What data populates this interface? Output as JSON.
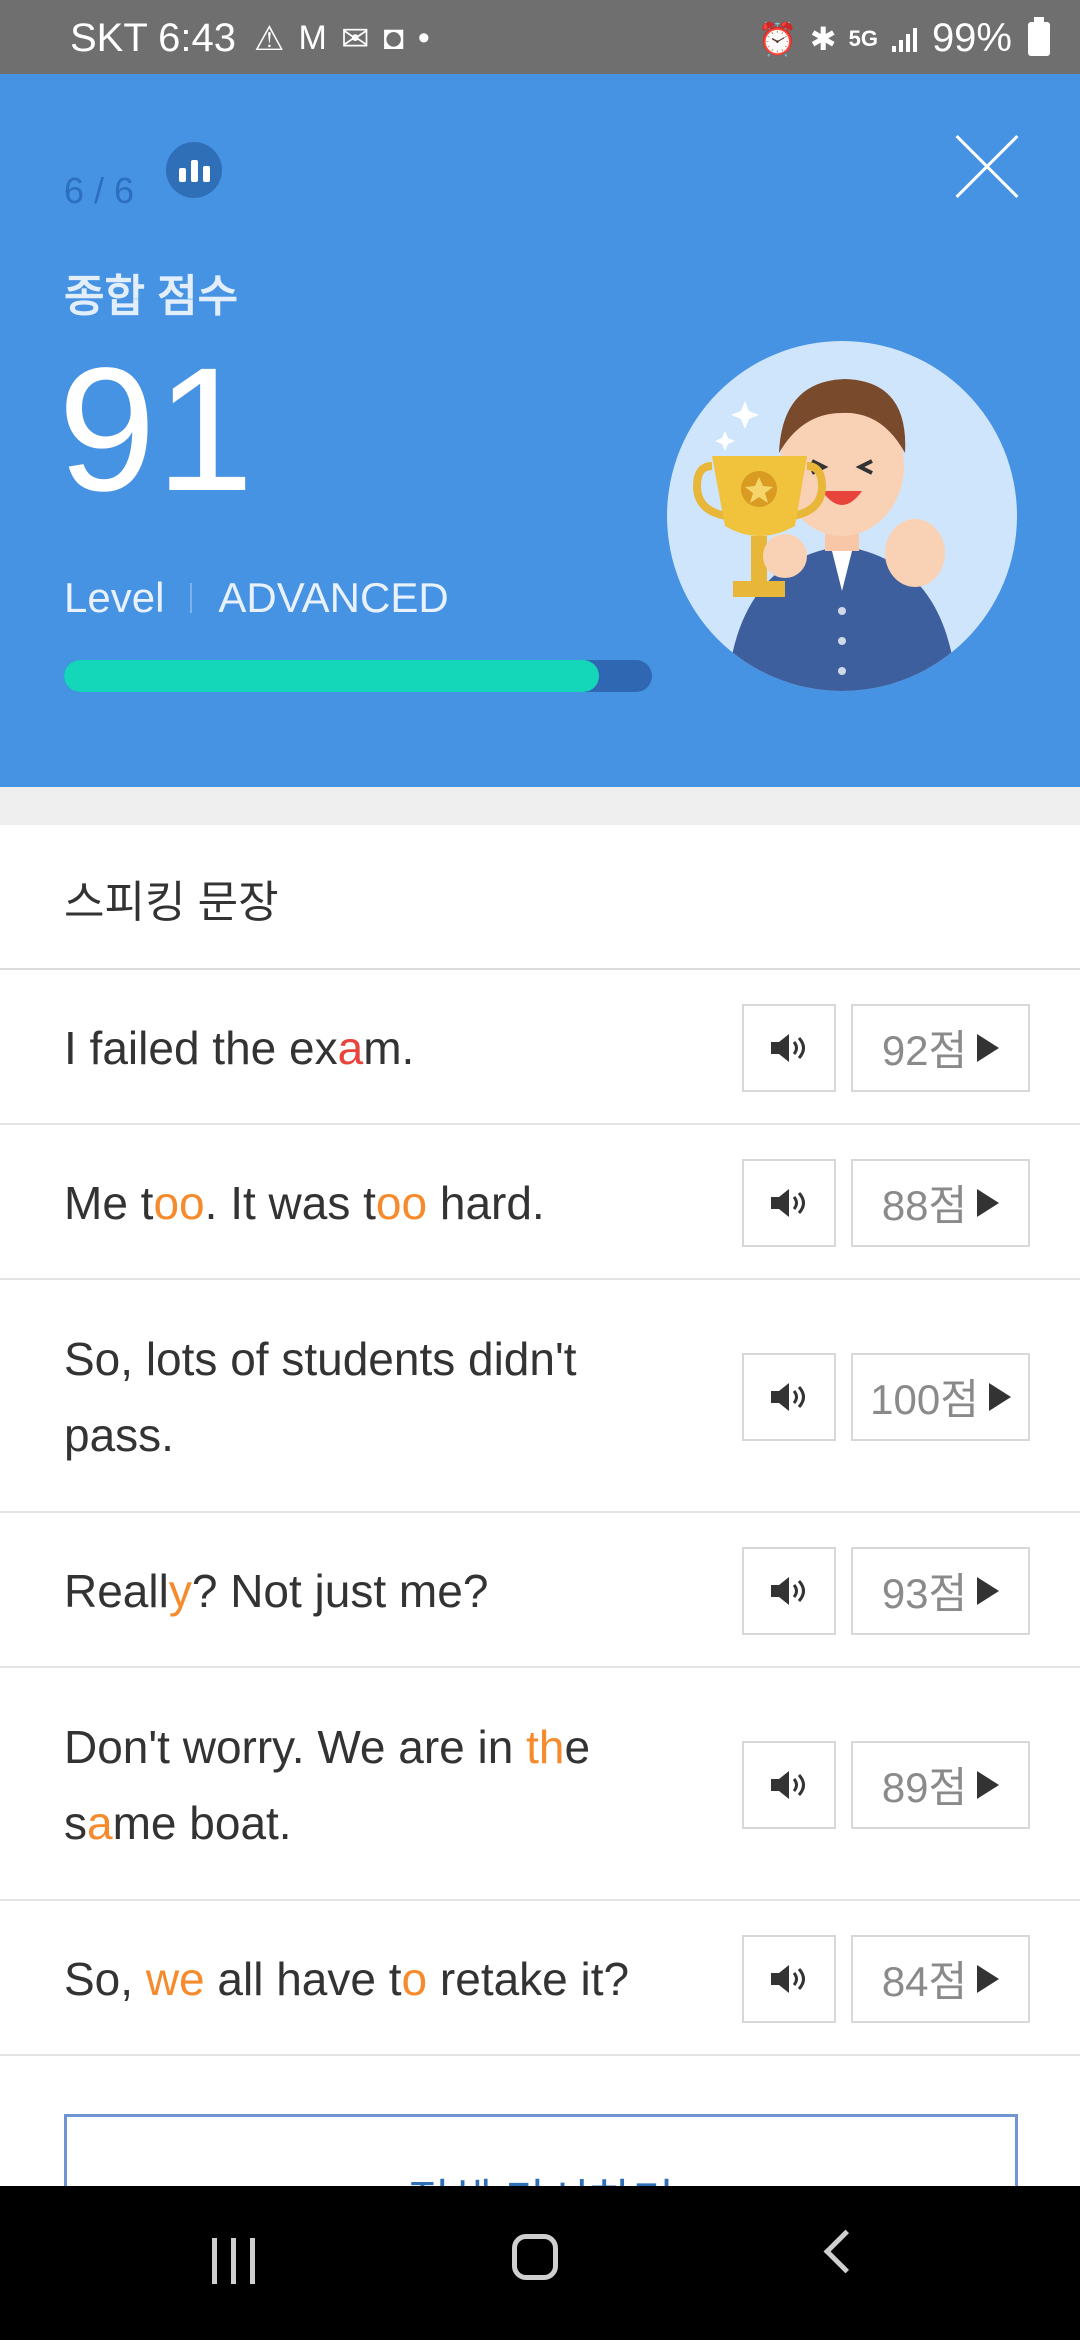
{
  "status_bar": {
    "carrier_time": "SKT 6:43",
    "left_icons": [
      "⚠",
      "M",
      "✉",
      "◘",
      "•"
    ],
    "right_icons": [
      "⏰",
      "✱",
      "5G"
    ],
    "battery": "99%"
  },
  "header": {
    "progress": "6 / 6",
    "score_label": "종합 점수",
    "score": "91",
    "level_label": "Level",
    "level_value": "ADVANCED",
    "score_fraction": 0.91,
    "colors": {
      "background": "#4692e3",
      "bar_fill": "#14d6b9",
      "bar_track": "#2f67b2"
    }
  },
  "section": {
    "title": "스피킹 문장"
  },
  "sentences": [
    {
      "parts": [
        {
          "t": "I failed the ex"
        },
        {
          "t": "a",
          "hl": "red"
        },
        {
          "t": "m."
        }
      ],
      "score": "92점"
    },
    {
      "parts": [
        {
          "t": "Me t"
        },
        {
          "t": "oo",
          "hl": "orange"
        },
        {
          "t": ". It was t"
        },
        {
          "t": "oo",
          "hl": "orange"
        },
        {
          "t": " hard."
        }
      ],
      "score": "88점"
    },
    {
      "parts": [
        {
          "t": "So, lots of students didn't pass."
        }
      ],
      "score": "100점"
    },
    {
      "parts": [
        {
          "t": "Reall"
        },
        {
          "t": "y",
          "hl": "orange"
        },
        {
          "t": "? Not just me?"
        }
      ],
      "score": "93점"
    },
    {
      "parts": [
        {
          "t": "Don't worry. We are in "
        },
        {
          "t": "th",
          "hl": "orange"
        },
        {
          "t": "e s"
        },
        {
          "t": "a",
          "hl": "orange"
        },
        {
          "t": "me boat."
        }
      ],
      "score": "89점"
    },
    {
      "parts": [
        {
          "t": "So, "
        },
        {
          "t": "we",
          "hl": "orange"
        },
        {
          "t": " all have t"
        },
        {
          "t": "o",
          "hl": "orange"
        },
        {
          "t": " retake it?"
        }
      ],
      "score": "84점"
    }
  ],
  "retry_button": {
    "label": "전체 다시하기"
  }
}
